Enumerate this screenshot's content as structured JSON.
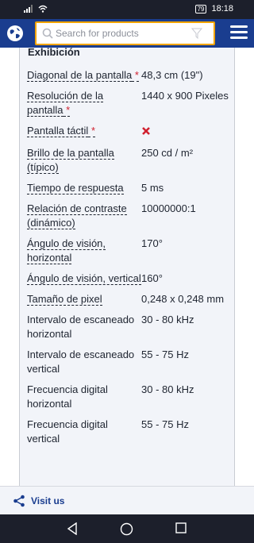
{
  "status": {
    "time": "18:18",
    "battery": "79"
  },
  "search": {
    "placeholder": "Search for products"
  },
  "section": {
    "title": "Exhibición"
  },
  "specs": [
    {
      "label": "Diagonal de la pantalla",
      "required": true,
      "value": "48,3 cm (19\")"
    },
    {
      "label": "Resolución de la pantalla",
      "required": true,
      "value": "1440 x 900 Pixeles"
    },
    {
      "label": "Pantalla táctil",
      "required": true,
      "value": "",
      "icon": "red-x-icon"
    },
    {
      "label": "Brillo de la pantalla (típico)",
      "required": false,
      "value": "250 cd / m²"
    },
    {
      "label": "Tiempo de respuesta",
      "required": false,
      "value": "5 ms"
    },
    {
      "label": "Relación de contraste (dinámico)",
      "required": false,
      "value": "10000000:1"
    },
    {
      "label": "Ángulo de visión, horizontal",
      "required": false,
      "value": "170°"
    },
    {
      "label": "Ángulo de visión, vertical",
      "required": false,
      "value": "160°"
    },
    {
      "label": "Tamaño de pixel",
      "required": false,
      "value": "0,248 x 0,248 mm"
    },
    {
      "label": "Intervalo de escaneado horizontal",
      "required": false,
      "value": "30 - 80 kHz"
    },
    {
      "label": "Intervalo de escaneado vertical",
      "required": false,
      "value": "55 - 75 Hz"
    },
    {
      "label": "Frecuencia digital horizontal",
      "required": false,
      "value": "30 - 80 kHz"
    },
    {
      "label": "Frecuencia digital vertical",
      "required": false,
      "value": "55 - 75 Hz"
    }
  ],
  "footer": {
    "visit_label": "Visit us"
  },
  "colors": {
    "brand": "#1a3d8f",
    "accent": "#f2a400",
    "required": "#d0202f"
  }
}
